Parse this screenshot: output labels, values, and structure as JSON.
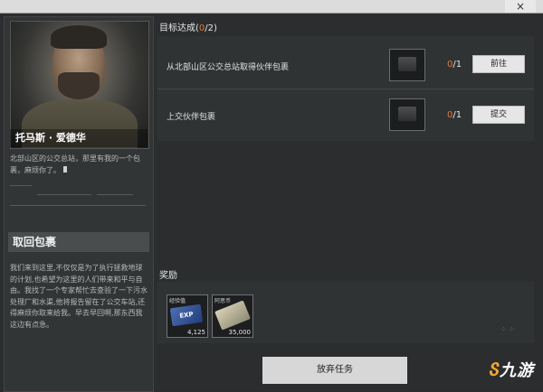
{
  "window": {
    "close_glyph": "×"
  },
  "npc": {
    "name": "托马斯 · 爱德华",
    "intro": "北部山区的公交总站，那里有我的一个包裹，麻烦你了。"
  },
  "quest": {
    "title": "取回包裹",
    "story": "我们来到这里,不仅仅是为了执行拯救地球的计划,也希望为这里的人们带来和平与自由。我找了一个专家帮忙去查验了一下污水处理厂和水渠,他将报告留在了公交车站,还得麻烦你取来给我。早去早回啊,那东西我这边有点急。"
  },
  "objectives": {
    "header": "目标达成",
    "done": "0",
    "total": "/2",
    "items": [
      {
        "label": "从北部山区公交总站取得伙伴包裹",
        "current": "0",
        "total": "/1",
        "action": "前往",
        "icon": "package-icon"
      },
      {
        "label": "上交伙伴包裹",
        "current": "0",
        "total": "/1",
        "action": "提交",
        "icon": "package-icon"
      }
    ]
  },
  "rewards": {
    "header": "奖励",
    "items": [
      {
        "name": "经验值",
        "badge": "EXP",
        "quantity": "4,125",
        "icon": "exp-card-icon"
      },
      {
        "name": "阿思币",
        "quantity": "35,000",
        "icon": "cash-stack-icon"
      }
    ]
  },
  "footer": {
    "abandon_label": "放弃任务"
  },
  "watermark": {
    "text": "九游"
  }
}
